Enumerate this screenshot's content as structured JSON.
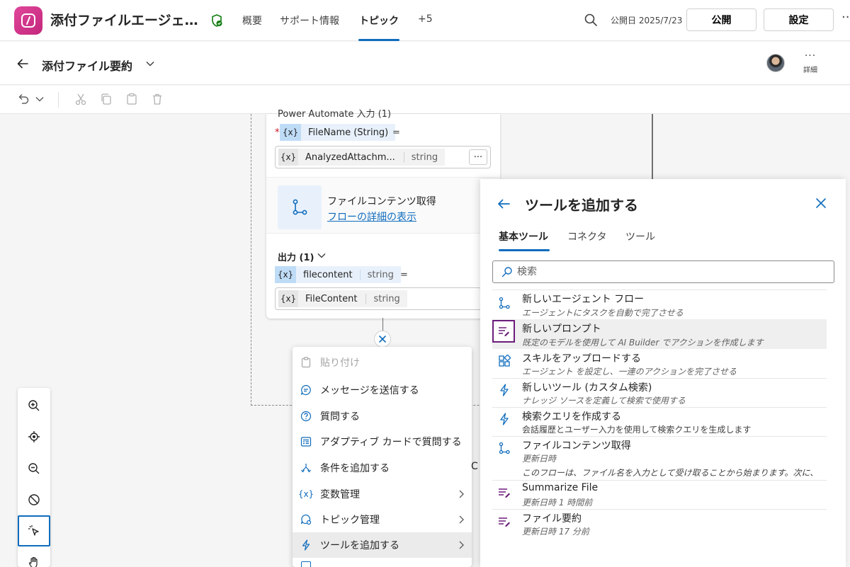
{
  "app": {
    "title": "添付ファイルエージェ…",
    "tabs": {
      "overview": "概要",
      "support": "サポート情報",
      "topic": "トピック",
      "more": "+5"
    },
    "publish_date": "公開日 2025/7/23",
    "publish_button": "公開",
    "settings_button": "設定",
    "accent_color": "#0f6cbd"
  },
  "topic_header": {
    "title": "添付ファイル要約",
    "details_label": "詳細"
  },
  "node": {
    "input_section_label": "Power Automate 入力 (1)",
    "input_variable": {
      "x": "{x}",
      "name": "FileName (String)",
      "eq": "="
    },
    "input_value": {
      "x": "{x}",
      "name": "AnalyzedAttachm...",
      "type": "string",
      "more": "···"
    },
    "flow": {
      "name": "ファイルコンテンツ取得",
      "link": "フローの詳細の表示"
    },
    "output_section_label": "出力 (1)",
    "output_variable": {
      "x": "{x}",
      "name": "filecontent",
      "type": "string",
      "eq": "="
    },
    "output_value": {
      "x": "{x}",
      "name": "FileContent",
      "type": "string"
    }
  },
  "context_menu": {
    "items": [
      {
        "label": "貼り付け",
        "icon": "paste-icon",
        "disabled": true
      },
      {
        "label": "メッセージを送信する",
        "icon": "message-icon"
      },
      {
        "label": "質問する",
        "icon": "question-icon"
      },
      {
        "label": "アダプティブ カードで質問する",
        "icon": "adaptive-card-icon"
      },
      {
        "label": "条件を追加する",
        "icon": "branch-icon"
      },
      {
        "label": "変数管理",
        "icon": "variable-icon",
        "submenu": true
      },
      {
        "label": "トピック管理",
        "icon": "topic-icon",
        "submenu": true
      },
      {
        "label": "ツールを追加する",
        "icon": "lightning-icon",
        "submenu": true,
        "active": true
      }
    ],
    "partial_label": "C"
  },
  "tool_panel": {
    "title": "ツールを追加する",
    "tabs": [
      "基本ツール",
      "コネクタ",
      "ツール"
    ],
    "search_placeholder": "検索",
    "items": [
      {
        "title": "新しいエージェント フロー",
        "desc": "エージェントにタスクを自動で完了させる",
        "icon": "flow-icon"
      },
      {
        "title": "新しいプロンプト",
        "desc": "既定のモデルを使用して AI Builder でアクションを作成します",
        "icon": "prompt-icon",
        "highlight": true
      },
      {
        "title": "スキルをアップロードする",
        "desc": "エージェント を設定し、一連のアクションを完了させる",
        "icon": "skill-icon"
      },
      {
        "title": "新しいツール (カスタム検索)",
        "desc": "ナレッジ ソースを定義して検索で使用する",
        "icon": "lightning-icon"
      },
      {
        "title": "検索クエリを作成する",
        "desc": "会話履歴とユーザー入力を使用して検索クエリを生成します",
        "icon": "lightning-icon"
      },
      {
        "title": "ファイルコンテンツ取得",
        "desc": "更新日時",
        "desc2": "このフローは、ファイル名を入力として受け取ることから始まります。次に、",
        "icon": "flow-icon"
      },
      {
        "title": "Summarize File",
        "desc": "更新日時 1 時間前",
        "icon": "prompt-icon"
      },
      {
        "title": "ファイル要約",
        "desc": "更新日時 17 分前",
        "icon": "prompt-icon"
      }
    ]
  }
}
